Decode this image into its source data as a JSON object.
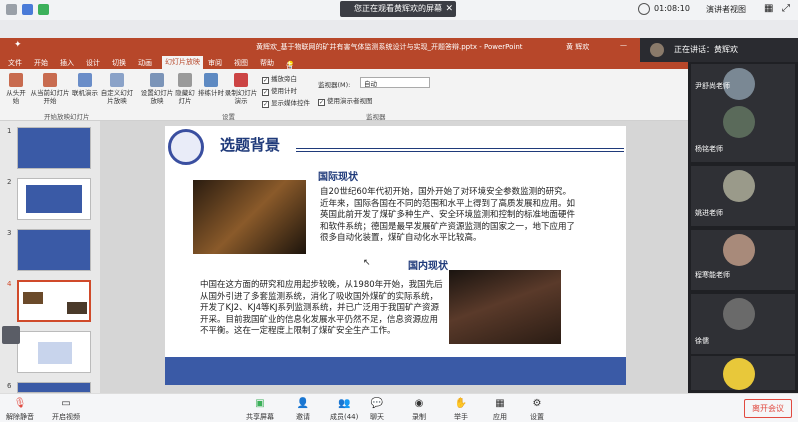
{
  "meeting": {
    "share_banner": "您正在观看黄辉欢的屏幕",
    "timer": "01:08:10",
    "presenter_view": "演讲者视图",
    "speaking": "正在讲话：黄辉欢"
  },
  "ppt": {
    "title": "黄辉欢_基于物联网的矿井有害气体监测系统设计与实现_开题答辩.pptx - PowerPoint",
    "user": "黄 辉欢",
    "tabs": [
      "文件",
      "开始",
      "插入",
      "设计",
      "切换",
      "动画",
      "幻灯片放映",
      "审阅",
      "视图",
      "帮助"
    ],
    "active_tab": "幻灯片放映",
    "tell_me": "告诉我你想要做什么",
    "ribbon": {
      "from_start": "从头开始",
      "from_current": "从当前幻灯片开始",
      "online": "联机演示",
      "custom": "自定义幻灯片放映",
      "group1": "开始放映幻灯片",
      "setup": "设置幻灯片放映",
      "hide": "隐藏幻灯片",
      "rehearse": "排练计时",
      "record": "录制幻灯片演示",
      "group2": "设置",
      "chk_narration": "播放旁白",
      "chk_timing": "使用计时",
      "chk_media": "显示媒体控件",
      "monitor_label": "监视器(M):",
      "monitor_value": "自动",
      "presenter_chk": "使用演示者视图",
      "group3": "监视器"
    },
    "thumb_numbers": [
      "1",
      "2",
      "3",
      "4",
      "5",
      "6"
    ]
  },
  "slide": {
    "title": "选题背景",
    "sub1": "国际现状",
    "para1": "自20世纪60年代初开始，国外开始了对环境安全参数监测的研究。近年来，国际各国在不同的范围和水平上得到了高质发展和应用。如英国此前开发了煤矿多种生产、安全环境监测和控制的标准地面硬件和软件系统；德国是最早发展矿产资源监测的国家之一，地下应用了很多自动化装置，煤矿自动化水平比较高。",
    "sub2": "国内现状",
    "para2": "中国在这方面的研究和应用起步较晚，从1980年开始，我国先后从国外引进了多套监测系统，消化了吸收国外煤矿的实际系统，开发了KJ2、KJ4等KJ系列监测系统，并已广泛用于我国矿产资源开采。目前我国矿业的信息化发展水平仍然不足，信息资源应用不平衡。这在一定程度上限制了煤矿安全生产工作。"
  },
  "participants": [
    {
      "name": "尹舒尚老师"
    },
    {
      "name": "杨铭老师"
    },
    {
      "name": "姚进老师"
    },
    {
      "name": "程寒能老师"
    },
    {
      "name": "徐儒"
    }
  ],
  "toolbar": {
    "mute": "解除静音",
    "video": "开启视频",
    "share": "共享屏幕",
    "invite": "邀请",
    "members": "成员(44)",
    "chat": "聊天",
    "record": "录制",
    "raise": "举手",
    "apps": "应用",
    "settings": "设置",
    "leave": "离开会议"
  },
  "colors": {
    "ppt_red": "#b7472a",
    "slide_blue": "#1f3a7a",
    "leave_red": "#e14a40"
  }
}
